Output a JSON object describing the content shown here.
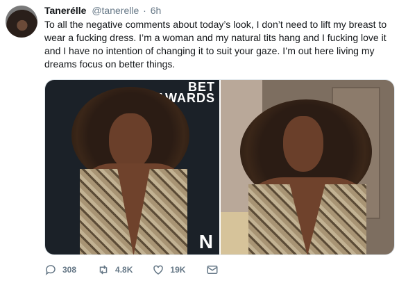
{
  "tweet": {
    "display_name": "Tanerélle",
    "handle": "@tanerelle",
    "separator": "·",
    "time": "6h",
    "text": "To all the negative comments about today’s look, I don’t need to lift my breast to\nwear a fucking dress. I’m a woman and my natural tits hang and I fucking love it\nand I have no intention of changing it to suit your gaze. I’m out here living my\ndreams focus on better things."
  },
  "media": {
    "left_photo": {
      "backdrop_logo": "BET\nAWARDS",
      "backdrop_letter": "N"
    },
    "right_photo": {}
  },
  "actions": {
    "reply_count": "308",
    "retweet_count": "4.8K",
    "like_count": "19K"
  },
  "icons": {
    "reply": "reply-icon",
    "retweet": "retweet-icon",
    "like": "heart-icon",
    "dm": "envelope-icon"
  },
  "colors": {
    "text": "#14171a",
    "muted": "#657786",
    "border": "#e1e8ed"
  }
}
